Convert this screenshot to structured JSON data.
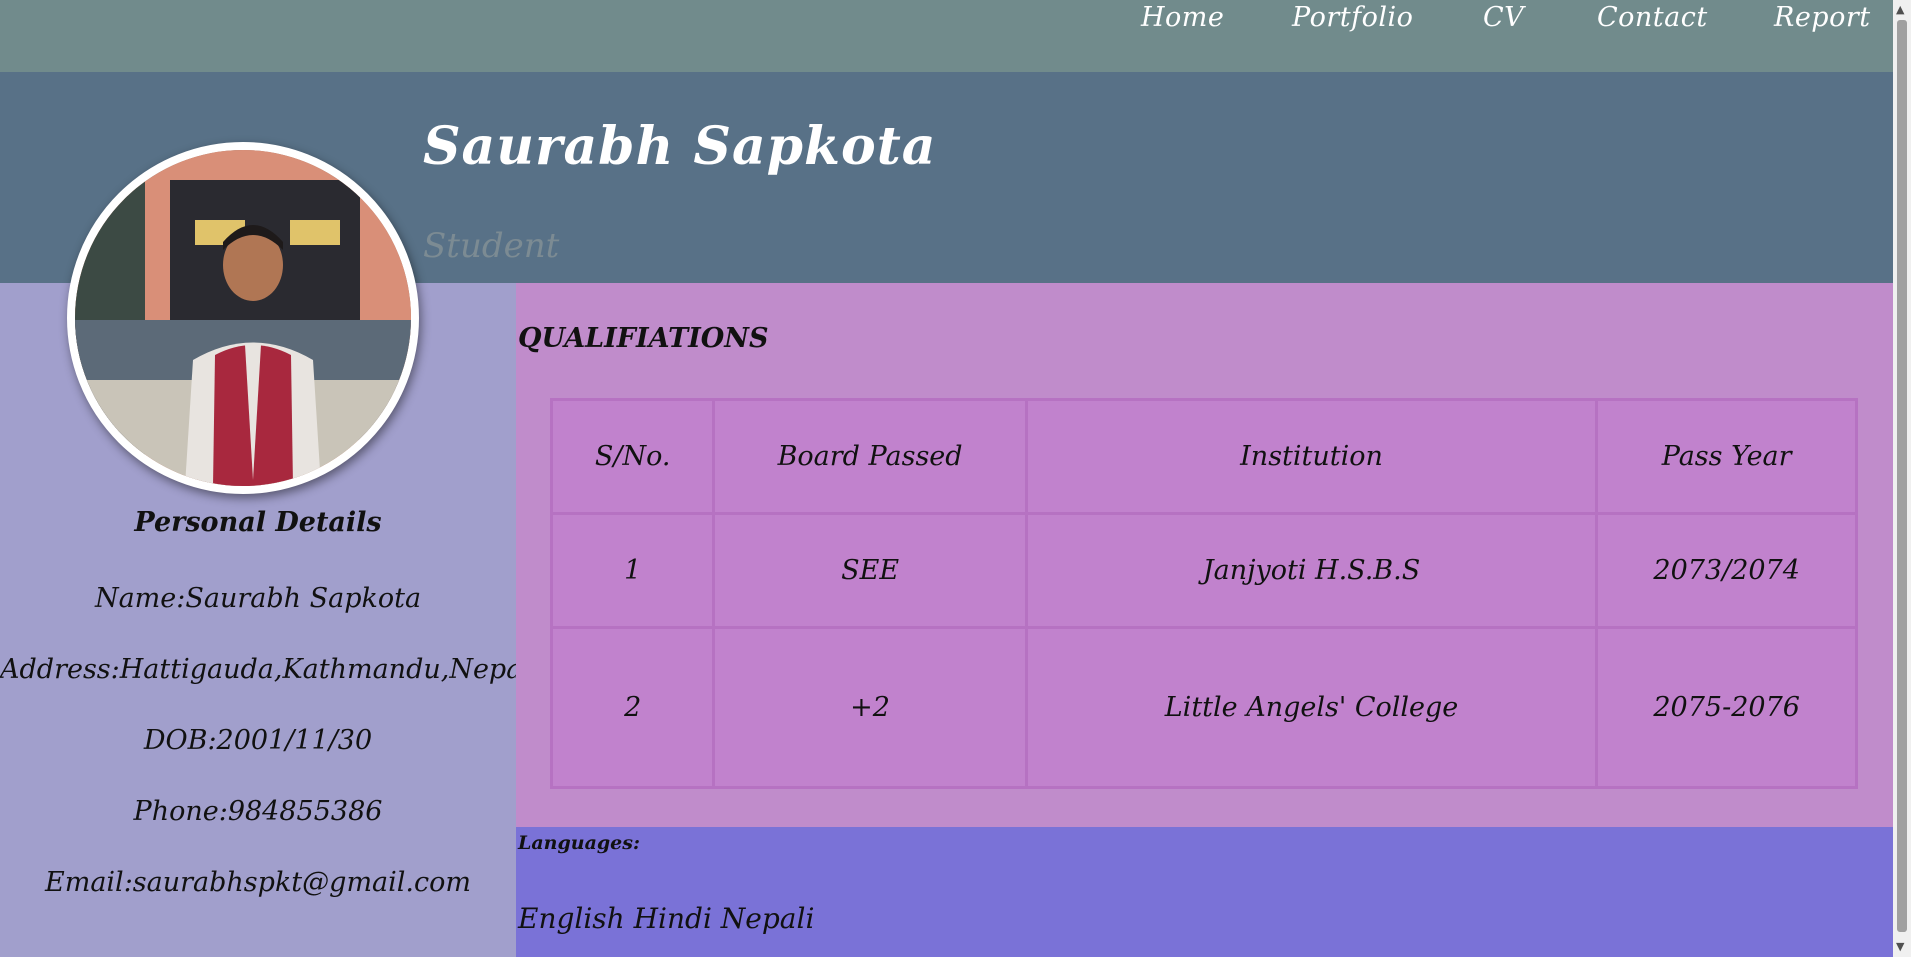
{
  "nav": {
    "items": [
      {
        "label": "Home"
      },
      {
        "label": "Portfolio"
      },
      {
        "label": "CV"
      },
      {
        "label": "Contact"
      },
      {
        "label": "Report"
      }
    ]
  },
  "header": {
    "name": "Saurabh Sapkota",
    "role": "Student"
  },
  "sidebar": {
    "title": "Personal Details",
    "name": "Name:Saurabh Sapkota",
    "address": "Address:Hattigauda,Kathmandu,Nepal",
    "dob": "DOB:2001/11/30",
    "phone": "Phone:984855386",
    "email": "Email:saurabhspkt@gmail.com"
  },
  "qualifications": {
    "title": "QUALIFIATIONS",
    "headers": [
      "S/No.",
      "Board Passed",
      "Institution",
      "Pass Year"
    ],
    "rows": [
      [
        "1",
        "SEE",
        "Janjyoti H.S.B.S",
        "2073/2074"
      ],
      [
        "2",
        "+2",
        "Little Angels' College",
        "2075-2076"
      ]
    ]
  },
  "languages": {
    "title": "Languages:",
    "list": "English Hindi Nepali"
  },
  "colors": {
    "nav_bg": "#718b8c",
    "header_bg": "#587187",
    "sidebar_bg": "#a19fcc",
    "main_bg": "#c08ccb",
    "table_bg": "#c182cd",
    "languages_bg": "#7a72d7"
  }
}
